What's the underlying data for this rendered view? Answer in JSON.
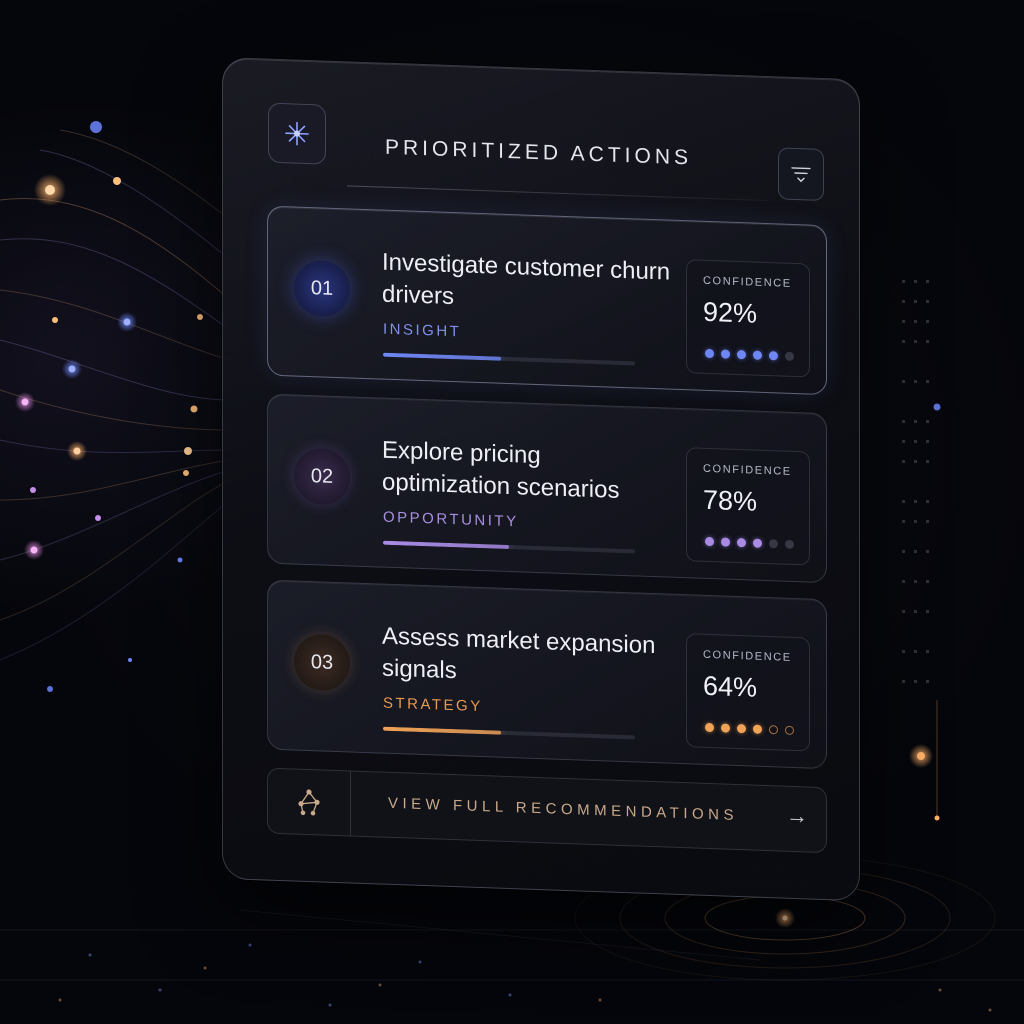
{
  "header": {
    "title": "PRIORITIZED ACTIONS",
    "logo_icon": "sparkle-icon",
    "filter_icon": "filter-icon"
  },
  "actions": [
    {
      "number": "01",
      "title": "Investigate customer churn drivers",
      "category": "INSIGHT",
      "confidence_label": "CONFIDENCE",
      "confidence_value": "92%",
      "confidence": 0.92,
      "progress": 0.47,
      "filled_dots": 5,
      "total_dots": 6,
      "accent": "#6f86f5",
      "category_color": "#7f90ec",
      "dot_empty_style": "dim"
    },
    {
      "number": "02",
      "title": "Explore pricing optimization scenarios",
      "category": "OPPORTUNITY",
      "confidence_label": "CONFIDENCE",
      "confidence_value": "78%",
      "confidence": 0.78,
      "progress": 0.5,
      "filled_dots": 4,
      "total_dots": 6,
      "accent": "#a98be6",
      "category_color": "#a88fe0",
      "dot_empty_style": "dim"
    },
    {
      "number": "03",
      "title": "Assess market expansion signals",
      "category": "STRATEGY",
      "confidence_label": "CONFIDENCE",
      "confidence_value": "64%",
      "confidence": 0.64,
      "progress": 0.47,
      "filled_dots": 4,
      "total_dots": 6,
      "accent": "#f0a256",
      "category_color": "#e69a52",
      "dot_empty_style": "outline"
    }
  ],
  "footer": {
    "label": "VIEW FULL RECOMMENDATIONS",
    "icon": "network-icon",
    "arrow": "→"
  },
  "colors": {
    "background": "#05060b",
    "panel": "#14151d",
    "text": "#eeeff5",
    "footer_text": "#c9a98a"
  }
}
